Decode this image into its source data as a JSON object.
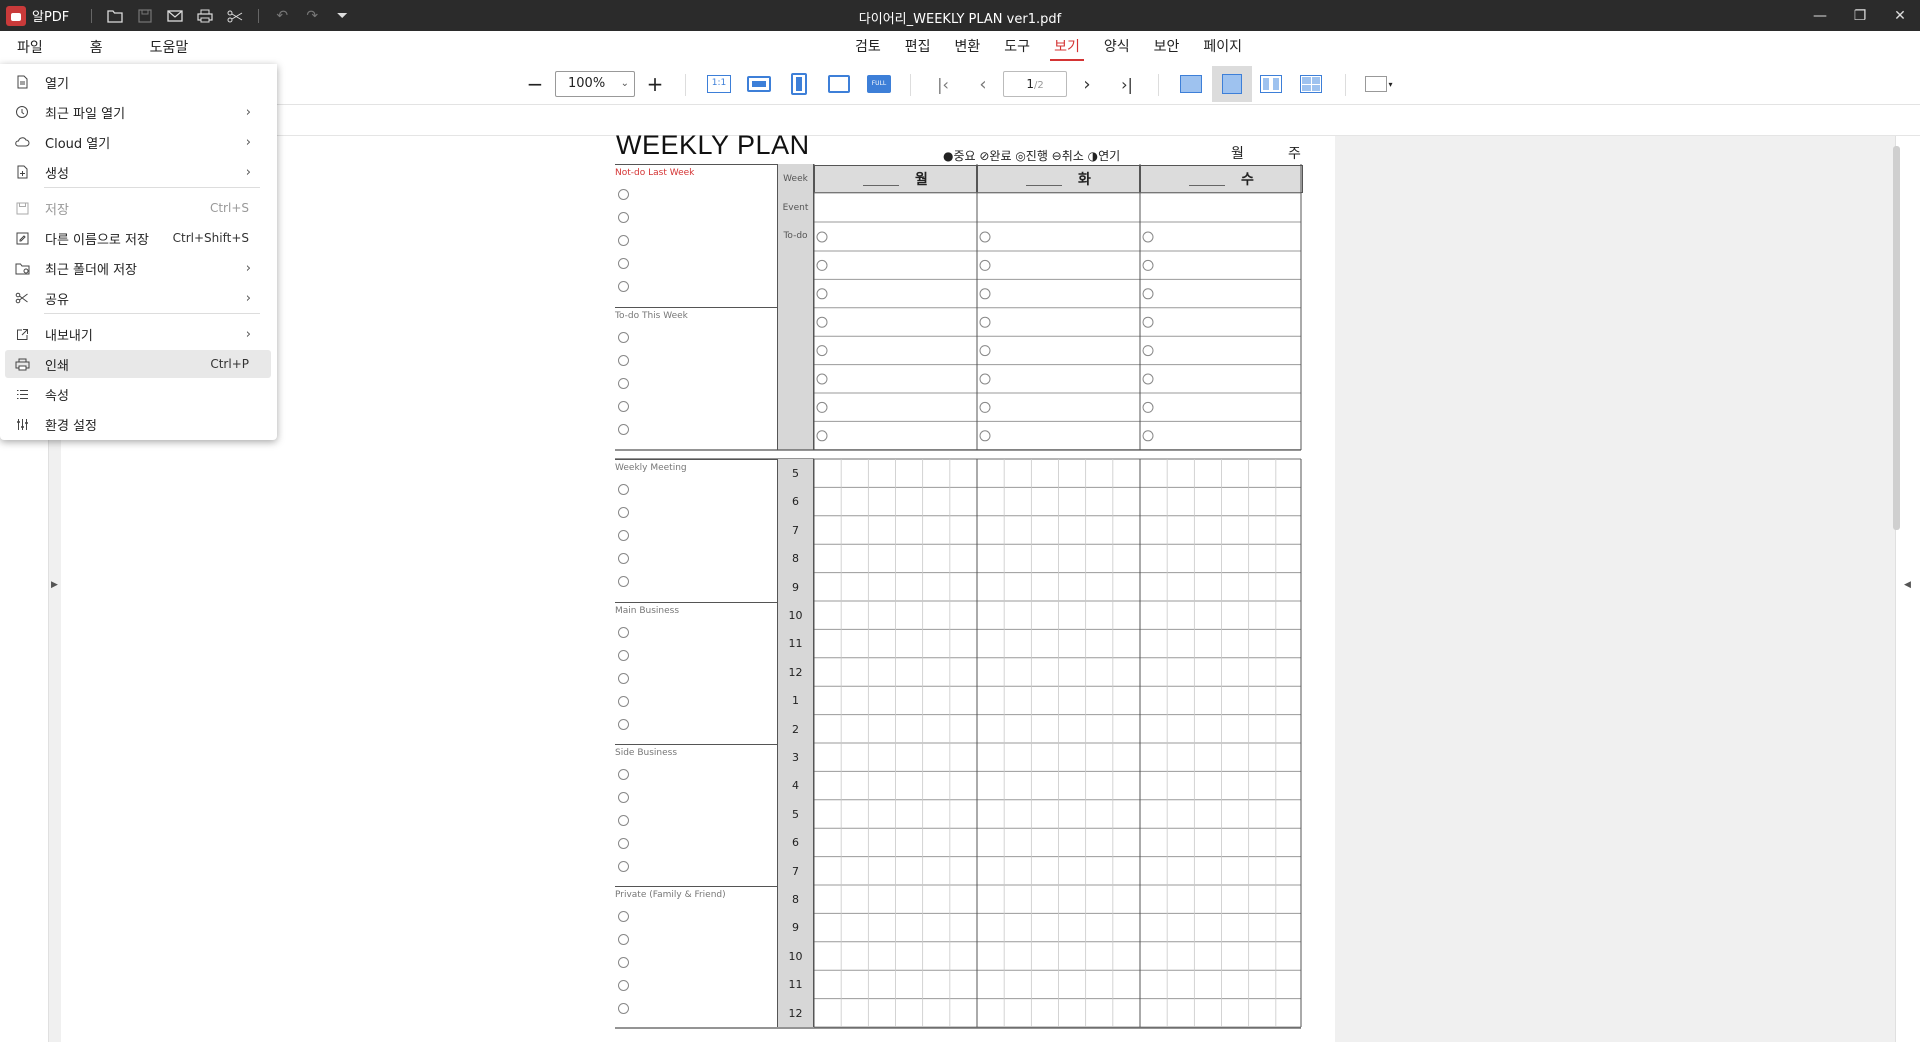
{
  "app": {
    "name": "알PDF",
    "document_title": "다이어리_WEEKLY PLAN ver1.pdf"
  },
  "menubar": {
    "left": [
      "파일",
      "홈",
      "도움말"
    ],
    "tabs": [
      "검토",
      "편집",
      "변환",
      "도구",
      "보기",
      "양식",
      "보안",
      "페이지"
    ],
    "active_tab": "보기"
  },
  "toolbar": {
    "zoom": "100%",
    "page_current": "1",
    "page_total": "/2",
    "fit_page_label": "1:1",
    "full_label": "FULL"
  },
  "file_menu": {
    "items": [
      {
        "label": "열기",
        "icon": "open-file-icon",
        "shortcut": "",
        "submenu": false,
        "disabled": false
      },
      {
        "label": "최근 파일 열기",
        "icon": "clock-icon",
        "shortcut": "",
        "submenu": true,
        "disabled": false
      },
      {
        "label": "Cloud 열기",
        "icon": "cloud-icon",
        "shortcut": "",
        "submenu": true,
        "disabled": false
      },
      {
        "label": "생성",
        "icon": "new-file-icon",
        "shortcut": "",
        "submenu": true,
        "disabled": false
      },
      {
        "label": "저장",
        "icon": "save-icon",
        "shortcut": "Ctrl+S",
        "submenu": false,
        "disabled": true
      },
      {
        "label": "다른 이름으로 저장",
        "icon": "save-as-icon",
        "shortcut": "Ctrl+Shift+S",
        "submenu": false,
        "disabled": false
      },
      {
        "label": "최근 폴더에 저장",
        "icon": "folder-save-icon",
        "shortcut": "",
        "submenu": true,
        "disabled": false
      },
      {
        "label": "공유",
        "icon": "share-icon",
        "shortcut": "",
        "submenu": true,
        "disabled": false
      },
      {
        "label": "내보내기",
        "icon": "export-icon",
        "shortcut": "",
        "submenu": true,
        "disabled": false
      },
      {
        "label": "인쇄",
        "icon": "print-icon",
        "shortcut": "Ctrl+P",
        "submenu": false,
        "disabled": false
      },
      {
        "label": "속성",
        "icon": "list-icon",
        "shortcut": "",
        "submenu": false,
        "disabled": false
      },
      {
        "label": "환경 설정",
        "icon": "settings-sliders-icon",
        "shortcut": "",
        "submenu": false,
        "disabled": false
      }
    ],
    "highlighted": "인쇄"
  },
  "weekly_plan": {
    "title": "WEEKLY PLAN",
    "legend": "●중요 ⊘완료 ◎진행 ⊖취소 ◑연기",
    "month_label": "월",
    "week_label": "주",
    "sections": [
      "Not-do Last Week",
      "To-do This Week",
      "Weekly Meeting",
      "Main Business",
      "Side Business",
      "Private (Family & Friend)"
    ],
    "row_labels": [
      "Week",
      "Event",
      "To-do"
    ],
    "days": [
      "월",
      "화",
      "수"
    ],
    "hours": [
      "5",
      "6",
      "7",
      "8",
      "9",
      "10",
      "11",
      "12",
      "1",
      "2",
      "3",
      "4",
      "5",
      "6",
      "7",
      "8",
      "9",
      "10",
      "11",
      "12"
    ]
  },
  "colors": {
    "titlebar": "#2b2b2b",
    "accent_red": "#d43434",
    "accent_blue": "#3d7fd8"
  }
}
